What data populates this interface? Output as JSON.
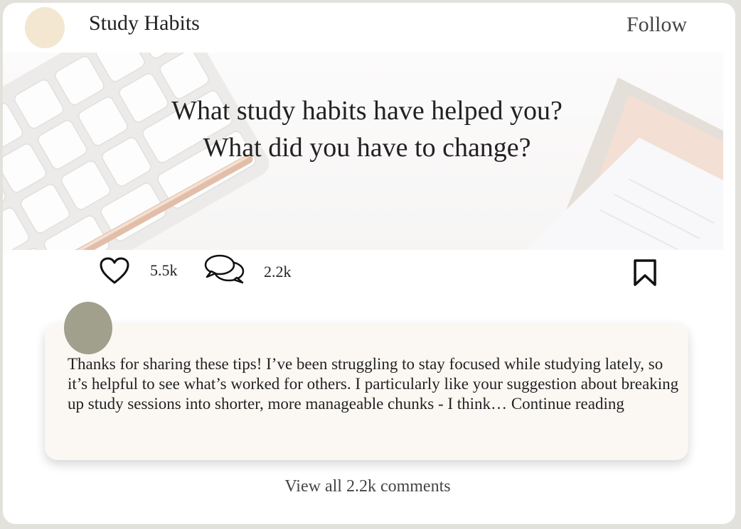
{
  "post": {
    "title": "Study Habits",
    "follow_label": "Follow",
    "hero_line1": "What study habits have helped you?",
    "hero_line2": "What did you have to change?"
  },
  "actions": {
    "likes": "5.5k",
    "comments": "2.2k",
    "icons": [
      "heart-icon",
      "comments-icon",
      "bookmark-icon"
    ]
  },
  "comment": {
    "text": "Thanks for sharing these tips! I’ve been struggling to stay focused while studying lately, so it’s helpful to see what’s worked for others. I particularly like your suggestion about breaking up study sessions into shorter, more manageable chunks - I think…",
    "more_label": "Continue reading"
  },
  "footer": {
    "view_all_label": "View all 2.2k comments"
  },
  "colors": {
    "background": "#e3e1dc",
    "card": "#ffffff",
    "top_avatar": "#f4e7d1",
    "comment_avatar": "#a1a08c",
    "comment_card": "#fbf8f4"
  }
}
